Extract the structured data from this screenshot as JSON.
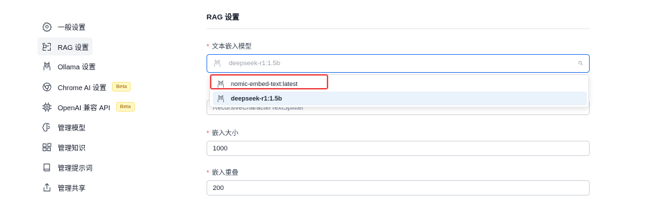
{
  "sidebar": {
    "items": [
      {
        "label": "一般设置",
        "icon": "settings-gear-icon",
        "active": false,
        "beta": ""
      },
      {
        "label": "RAG 设置",
        "icon": "rag-icon",
        "active": true,
        "beta": ""
      },
      {
        "label": "Ollama 设置",
        "icon": "ollama-llama-icon",
        "active": false,
        "beta": ""
      },
      {
        "label": "Chrome AI 设置",
        "icon": "chrome-icon",
        "active": false,
        "beta": "Beta"
      },
      {
        "label": "OpenAI 兼容 API",
        "icon": "chip-icon",
        "active": false,
        "beta": "Beta"
      },
      {
        "label": "管理模型",
        "icon": "brain-icon",
        "active": false,
        "beta": ""
      },
      {
        "label": "管理知识",
        "icon": "blocks-icon",
        "active": false,
        "beta": ""
      },
      {
        "label": "管理提示词",
        "icon": "book-icon",
        "active": false,
        "beta": ""
      },
      {
        "label": "管理共享",
        "icon": "share-icon",
        "active": false,
        "beta": ""
      }
    ]
  },
  "main": {
    "title": "RAG 设置",
    "embedding_model": {
      "required_mark": "*",
      "label": "文本嵌入模型",
      "placeholder": "deepseek-r1:1.5b",
      "options": [
        {
          "label": "nomic-embed-text:latest",
          "selected": false,
          "highlighted": true
        },
        {
          "label": "deepseek-r1:1.5b",
          "selected": true,
          "highlighted": false
        }
      ]
    },
    "splitter": {
      "value": "RecursiveCharacterTextSplitter"
    },
    "chunk_size": {
      "required_mark": "*",
      "label": "嵌入大小",
      "value": "1000"
    },
    "chunk_overlap": {
      "required_mark": "*",
      "label": "嵌入重叠",
      "value": "200"
    }
  },
  "colors": {
    "accent": "#3b82f6",
    "required": "#ef4444",
    "selected_bg": "#eaf2fb",
    "beta_bg": "#fef9c3",
    "beta_text": "#a16207"
  }
}
